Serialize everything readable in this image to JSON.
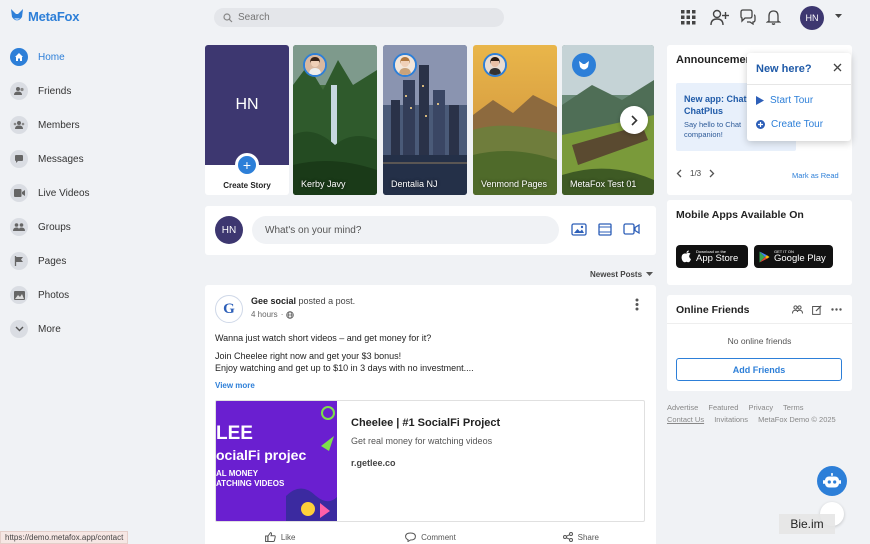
{
  "brand": {
    "name": "MetaFox",
    "color": "#2d7fd8"
  },
  "search": {
    "placeholder": "Search"
  },
  "user": {
    "initials": "HN"
  },
  "sidebar": {
    "items": [
      {
        "label": "Home",
        "icon": "home-icon",
        "active": true
      },
      {
        "label": "Friends",
        "icon": "friends-icon"
      },
      {
        "label": "Members",
        "icon": "members-icon"
      },
      {
        "label": "Messages",
        "icon": "messages-icon"
      },
      {
        "label": "Live Videos",
        "icon": "video-icon"
      },
      {
        "label": "Groups",
        "icon": "groups-icon"
      },
      {
        "label": "Pages",
        "icon": "flag-icon"
      },
      {
        "label": "Photos",
        "icon": "photos-icon"
      },
      {
        "label": "More",
        "icon": "chevron-down-icon"
      }
    ]
  },
  "stories": {
    "create": {
      "initials": "HN",
      "label": "Create Story"
    },
    "items": [
      {
        "name": "Kerby Javy"
      },
      {
        "name": "Dentalia NJ"
      },
      {
        "name": "Venmond Pages"
      },
      {
        "name": "MetaFox Test 01"
      }
    ]
  },
  "composer": {
    "initials": "HN",
    "placeholder": "What's on your mind?"
  },
  "feed": {
    "sort_label": "Newest Posts"
  },
  "post": {
    "author": "Gee social",
    "action": "posted a post.",
    "time": "4 hours",
    "logo_letter": "G",
    "line1": "Wanna just watch short videos – and get money for it?",
    "line2": "Join Cheelee right now and get your $3 bonus!",
    "line3": "Enjoy watching and get up to $10 in 3 days with no investment....",
    "view_more": "View more",
    "link": {
      "title": "Cheelee | #1 SocialFi Project",
      "description": "Get real money for watching videos",
      "domain": "r.getlee.co",
      "image_line1": "LEE",
      "image_line2": "ocialFi projec",
      "image_line3": "AL MONEY",
      "image_line4": "ATCHING VIDEOS"
    },
    "actions": {
      "like": "Like",
      "comment": "Comment",
      "share": "Share"
    }
  },
  "announcements": {
    "title": "Announcements",
    "item_title_1": "New app: Chat",
    "item_title_2": "ChatPlus",
    "item_sub_1": "Say hello to Chat",
    "item_sub_2": "companion!",
    "pager": "1/3",
    "mark_read": "Mark as Read"
  },
  "tour_popover": {
    "title": "New here?",
    "start": "Start Tour",
    "create": "Create Tour"
  },
  "mobile_apps": {
    "title": "Mobile Apps Available On",
    "app_store_small": "Download on the",
    "app_store": "App Store",
    "google_play_small": "GET IT ON",
    "google_play": "Google Play"
  },
  "online_friends": {
    "title": "Online Friends",
    "empty": "No online friends",
    "add_button": "Add Friends"
  },
  "footer": {
    "advertise": "Advertise",
    "featured": "Featured",
    "privacy": "Privacy",
    "terms": "Terms",
    "contact": "Contact Us",
    "invitations": "Invitations",
    "copyright": "MetaFox Demo © 2025"
  },
  "status_bar": {
    "url": "https://demo.metafox.app/contact"
  },
  "watermark": {
    "text": "Bie.im"
  }
}
